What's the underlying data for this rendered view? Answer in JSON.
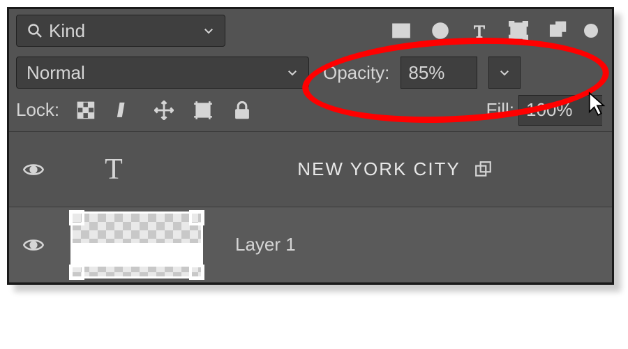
{
  "filter": {
    "label": "Kind"
  },
  "blend_mode": {
    "value": "Normal"
  },
  "opacity": {
    "label": "Opacity:",
    "value": "85%"
  },
  "lock": {
    "label": "Lock:"
  },
  "fill": {
    "label": "Fill:",
    "value": "100%"
  },
  "layers": [
    {
      "name": "NEW YORK CITY",
      "kind": "type",
      "visible": true
    },
    {
      "name": "Layer 1",
      "kind": "pixel",
      "visible": true
    }
  ]
}
